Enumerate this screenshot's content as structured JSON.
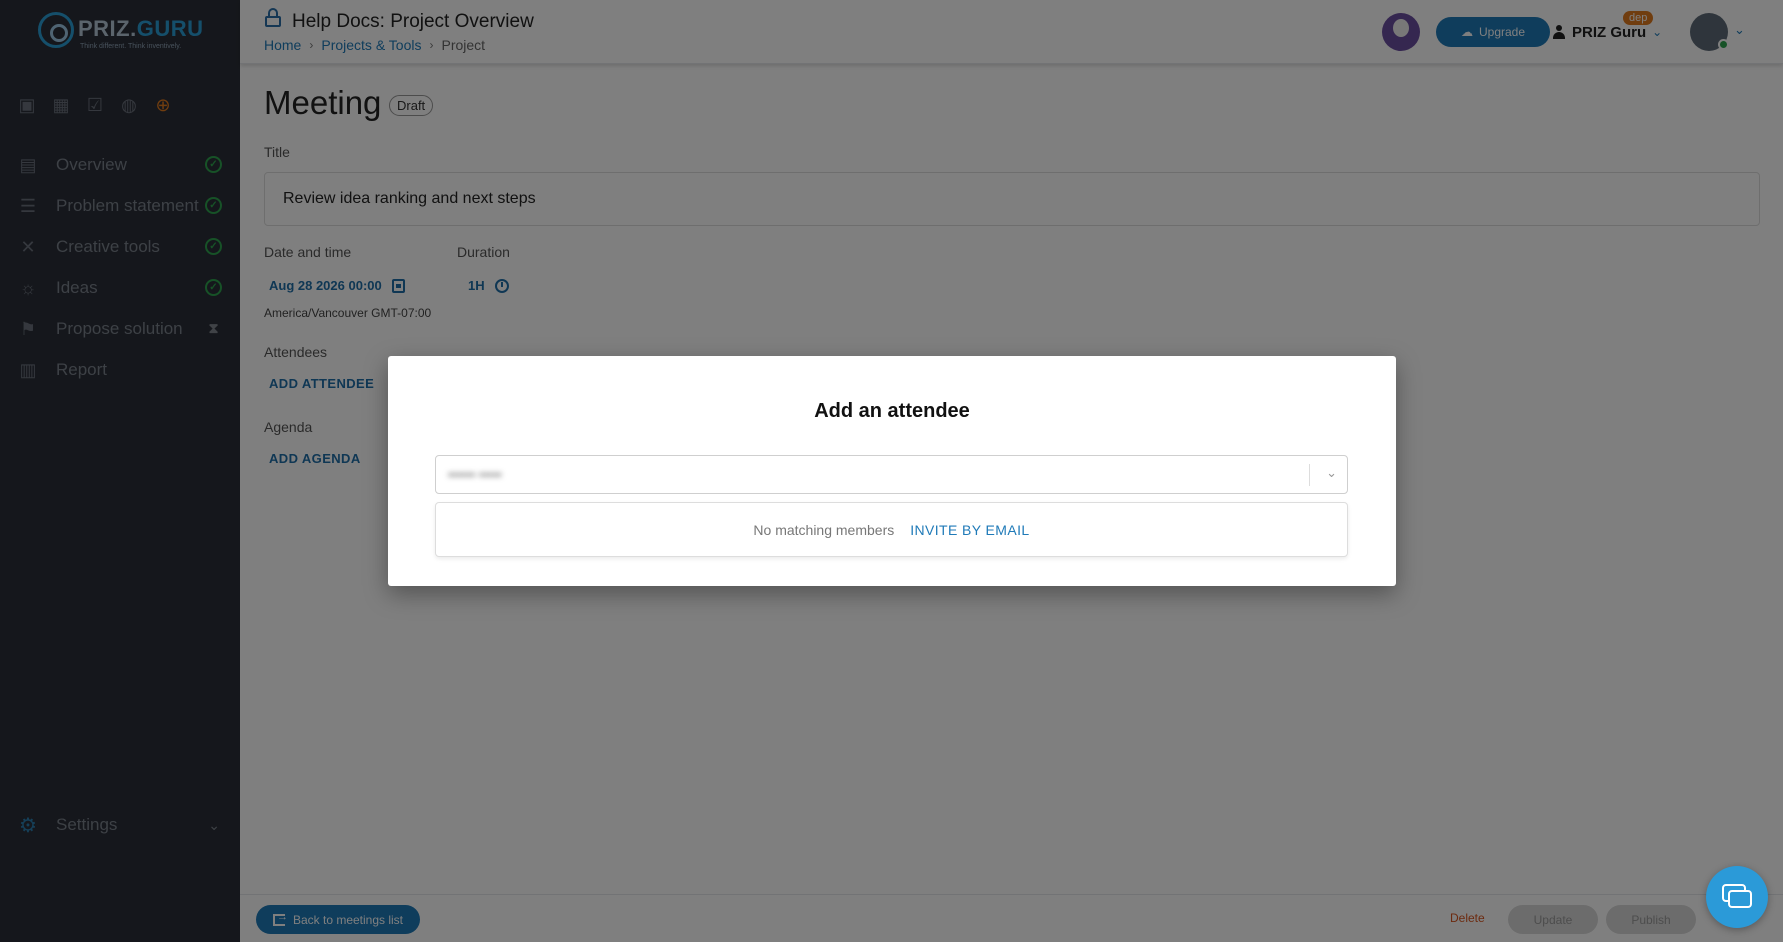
{
  "brand": {
    "name_a": "PRIZ.",
    "name_b": "GURU",
    "tagline": "Think different. Think inventively."
  },
  "sidebar": {
    "items": [
      {
        "label": "Overview",
        "icon": "document-icon",
        "status": "done"
      },
      {
        "label": "Problem statement",
        "icon": "stack-icon",
        "status": "done"
      },
      {
        "label": "Creative tools",
        "icon": "tools-icon",
        "status": "done"
      },
      {
        "label": "Ideas",
        "icon": "lightbulb-icon",
        "status": "done"
      },
      {
        "label": "Propose solution",
        "icon": "flag-icon",
        "status": "pending"
      },
      {
        "label": "Report",
        "icon": "pdf-icon",
        "status": "none"
      }
    ],
    "settings_label": "Settings"
  },
  "header": {
    "title": "Help Docs: Project Overview",
    "breadcrumb": {
      "home": "Home",
      "projects": "Projects & Tools",
      "current": "Project"
    },
    "upgrade_label": "Upgrade",
    "user_name": "PRIZ Guru",
    "env_badge": "dep"
  },
  "main": {
    "title": "Meeting",
    "status_badge": "Draft",
    "title_label": "Title",
    "title_value": "Review idea ranking and next steps",
    "date_label": "Date and time",
    "date_value": "Aug 28 2026 00:00",
    "timezone": "America/Vancouver GMT-07:00",
    "duration_label": "Duration",
    "duration_value": "1H",
    "attendees_label": "Attendees",
    "add_attendee": "ADD ATTENDEE",
    "agenda_label": "Agenda",
    "add_agenda": "ADD AGENDA"
  },
  "footer": {
    "back_label": "Back to meetings list",
    "delete_label": "Delete",
    "update_label": "Update",
    "publish_label": "Publish"
  },
  "dialog": {
    "title": "Add an attendee",
    "select_value": "•••••• •••••",
    "no_match": "No matching members",
    "invite_label": "INVITE BY EMAIL"
  },
  "colors": {
    "accent": "#1f7ab8",
    "sidebar_bg": "#2b2f38",
    "success": "#2ea44f",
    "danger": "#d9541e"
  }
}
